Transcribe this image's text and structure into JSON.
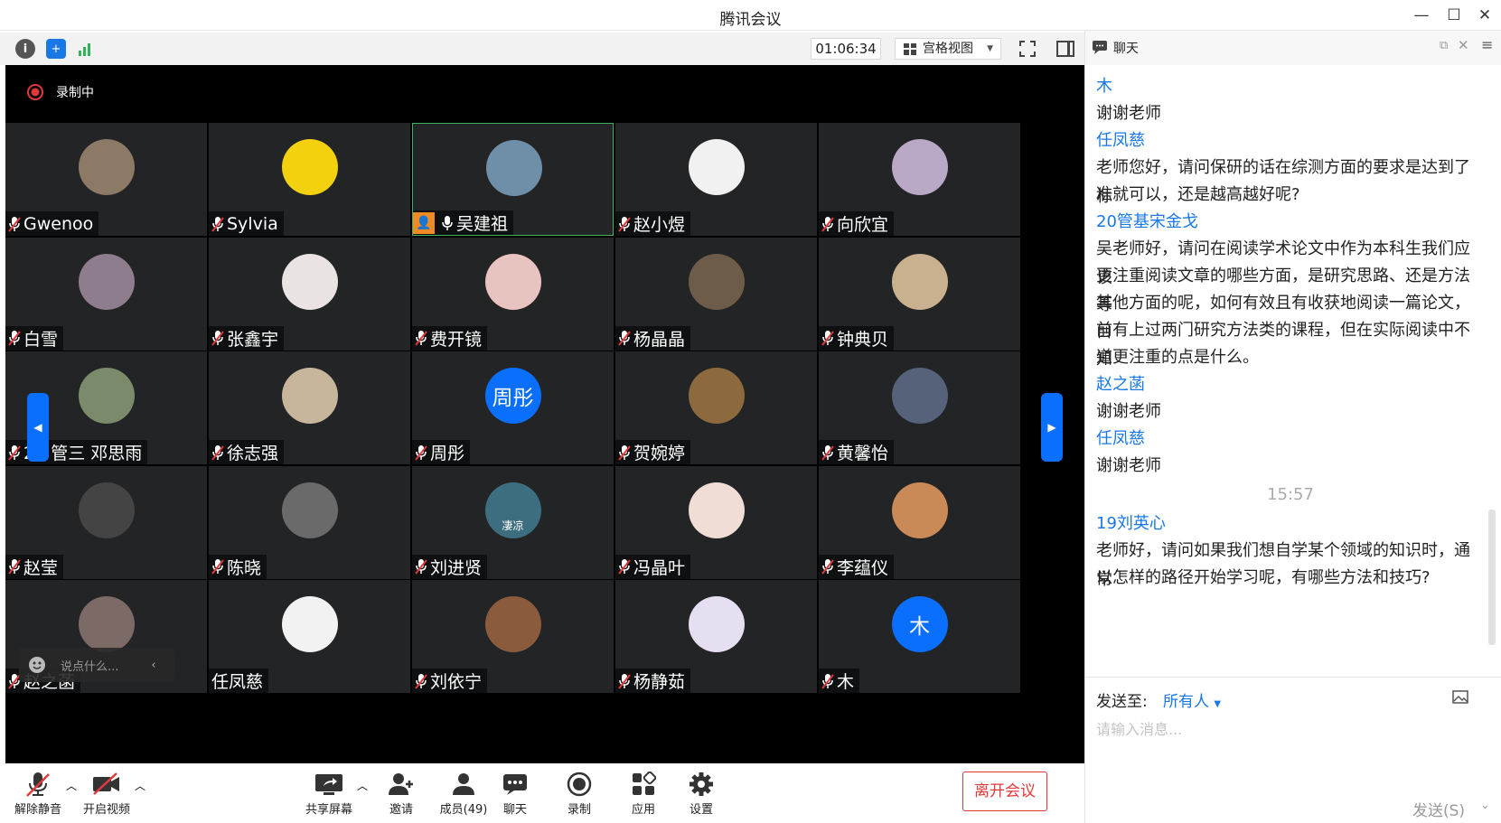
{
  "window": {
    "title": "腾讯会议",
    "controls": [
      "minimize-icon",
      "maximize-icon",
      "close-icon"
    ]
  },
  "toolbar": {
    "icons": [
      "info-icon",
      "shield-icon",
      "signal-icon"
    ],
    "timer": "01:06:34",
    "view_mode": "宫格视图"
  },
  "recording": {
    "label": "录制中"
  },
  "participants": [
    {
      "name": "Gwenoo",
      "avatar_color": "#8d7a66",
      "avatar_text": ""
    },
    {
      "name": "Sylvia",
      "avatar_color": "#f4d10e",
      "avatar_text": ""
    },
    {
      "name": "吴建祖",
      "avatar_color": "#6f8fa8",
      "avatar_text": "",
      "active": true,
      "host": true
    },
    {
      "name": "赵小煜",
      "avatar_color": "#f1f1f1",
      "avatar_text": ""
    },
    {
      "name": "向欣宜",
      "avatar_color": "#b9a9c6",
      "avatar_text": ""
    },
    {
      "name": "白雪",
      "avatar_color": "#8e7d8c",
      "avatar_text": ""
    },
    {
      "name": "张鑫宇",
      "avatar_color": "#e9e4e3",
      "avatar_text": ""
    },
    {
      "name": "费开镜",
      "avatar_color": "#e8c4c0",
      "avatar_text": ""
    },
    {
      "name": "杨晶晶",
      "avatar_color": "#6c5c49",
      "avatar_text": ""
    },
    {
      "name": "钟典贝",
      "avatar_color": "#c9b190",
      "avatar_text": ""
    },
    {
      "name": "21 管三 邓思雨",
      "avatar_color": "#7a8a6a",
      "avatar_text": ""
    },
    {
      "name": "徐志强",
      "avatar_color": "#c7b59c",
      "avatar_text": ""
    },
    {
      "name": "周彤",
      "avatar_color": "#0b6ffd",
      "avatar_text": "周彤"
    },
    {
      "name": "贺婉婷",
      "avatar_color": "#8d6a3e",
      "avatar_text": ""
    },
    {
      "name": "黄馨怡",
      "avatar_color": "#55627a",
      "avatar_text": ""
    },
    {
      "name": "赵莹",
      "avatar_color": "#444444",
      "avatar_text": ""
    },
    {
      "name": "陈晓",
      "avatar_color": "#6a6a6a",
      "avatar_text": ""
    },
    {
      "name": "刘进贤",
      "avatar_color": "#3d6e7f",
      "avatar_text": "凄凉"
    },
    {
      "name": "冯晶叶",
      "avatar_color": "#f0ddd5",
      "avatar_text": ""
    },
    {
      "name": "李蕴仪",
      "avatar_color": "#c98a58",
      "avatar_text": ""
    },
    {
      "name": "赵之菡",
      "avatar_color": "#7c6a66",
      "avatar_text": ""
    },
    {
      "name": "任凤慈",
      "avatar_color": "#f2f2f2",
      "avatar_text": ""
    },
    {
      "name": "刘依宁",
      "avatar_color": "#8a5b3c",
      "avatar_text": ""
    },
    {
      "name": "杨静茹",
      "avatar_color": "#e6dff2",
      "avatar_text": ""
    },
    {
      "name": "木",
      "avatar_color": "#0b6ffd",
      "avatar_text": "木"
    }
  ],
  "quick_chat": {
    "placeholder": "说点什么..."
  },
  "bottom_bar": {
    "unmute": "解除静音",
    "start_video": "开启视频",
    "share_screen": "共享屏幕",
    "invite": "邀请",
    "members": "成员(49)",
    "chat": "聊天",
    "record": "录制",
    "apps": "应用",
    "settings": "设置",
    "leave": "离开会议"
  },
  "chat": {
    "title": "聊天",
    "messages": [
      {
        "type": "sender",
        "text": "木"
      },
      {
        "type": "content",
        "text": "谢谢老师"
      },
      {
        "type": "sender",
        "text": "任凤慈"
      },
      {
        "type": "content",
        "text": "老师您好，请问保研的话在综测方面的要求是达到了标"
      },
      {
        "type": "content",
        "text": "准就可以，还是越高越好呢?"
      },
      {
        "type": "sender",
        "text": "20管基宋金戈"
      },
      {
        "type": "content",
        "text": "吴老师好，请问在阅读学术论文中作为本科生我们应该"
      },
      {
        "type": "content",
        "text": "更注重阅读文章的哪些方面，是研究思路、还是方法等"
      },
      {
        "type": "content",
        "text": "其他方面的呢，如何有效且有收获地阅读一篇论文，目"
      },
      {
        "type": "content",
        "text": "前有上过两门研究方法类的课程，但在实际阅读中不知"
      },
      {
        "type": "content",
        "text": "道更注重的点是什么。"
      },
      {
        "type": "sender",
        "text": "赵之菡"
      },
      {
        "type": "content",
        "text": "谢谢老师"
      },
      {
        "type": "sender",
        "text": "任凤慈"
      },
      {
        "type": "content",
        "text": "谢谢老师"
      },
      {
        "type": "timestamp",
        "text": "15:57"
      },
      {
        "type": "sender",
        "text": "19刘英心"
      },
      {
        "type": "content",
        "text": "老师好，请问如果我们想自学某个领域的知识时，通常"
      },
      {
        "type": "content",
        "text": "以怎样的路径开始学习呢，有哪些方法和技巧?"
      }
    ],
    "send_to_label": "发送至:",
    "send_to_target": "所有人",
    "input_placeholder": "请输入消息...",
    "send_button": "发送(S)"
  }
}
